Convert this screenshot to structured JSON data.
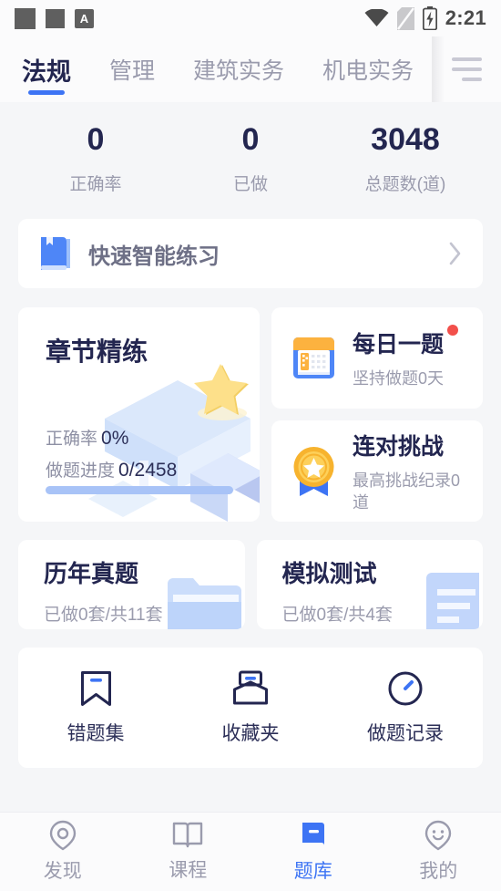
{
  "statusbar": {
    "time": "2:21",
    "app_badge": "A",
    "icons": [
      "square-icon",
      "square-icon",
      "a-badge-icon",
      "wifi-icon",
      "no-sim-icon",
      "battery-charging-icon"
    ]
  },
  "tabbar": {
    "tabs": [
      {
        "label": "法规",
        "active": true
      },
      {
        "label": "管理",
        "active": false
      },
      {
        "label": "建筑实务",
        "active": false
      },
      {
        "label": "机电实务",
        "active": false
      }
    ],
    "menu_label": "menu"
  },
  "stats": [
    {
      "value": "0",
      "label": "正确率"
    },
    {
      "value": "0",
      "label": "已做"
    },
    {
      "value": "3048",
      "label": "总题数(道)"
    }
  ],
  "quick_practice": {
    "title": "快速智能练习"
  },
  "chapter": {
    "title": "章节精练",
    "accuracy_label": "正确率",
    "accuracy_value": "0%",
    "progress_label": "做题进度",
    "progress_value": "0/2458"
  },
  "daily": {
    "title": "每日一题",
    "subtitle": "坚持做题0天",
    "has_badge": true
  },
  "streak": {
    "title": "连对挑战",
    "subtitle": "最高挑战纪录0道"
  },
  "exams": [
    {
      "title": "历年真题",
      "subtitle": "已做0套/共11套"
    },
    {
      "title": "模拟测试",
      "subtitle": "已做0套/共4套"
    }
  ],
  "tools": [
    {
      "label": "错题集",
      "icon": "bookmark-icon"
    },
    {
      "label": "收藏夹",
      "icon": "inbox-icon"
    },
    {
      "label": "做题记录",
      "icon": "clock-icon"
    }
  ],
  "bottomnav": [
    {
      "label": "发现",
      "icon": "discover-icon",
      "active": false
    },
    {
      "label": "课程",
      "icon": "book-open-icon",
      "active": false
    },
    {
      "label": "题库",
      "icon": "question-bank-icon",
      "active": true
    },
    {
      "label": "我的",
      "icon": "profile-icon",
      "active": false
    }
  ],
  "colors": {
    "accent_blue": "#3d74f4",
    "navy": "#232650",
    "muted": "#9a9bad",
    "badge_red": "#f2504b",
    "gold": "#fcc44a",
    "bg": "#f5f6f8"
  }
}
